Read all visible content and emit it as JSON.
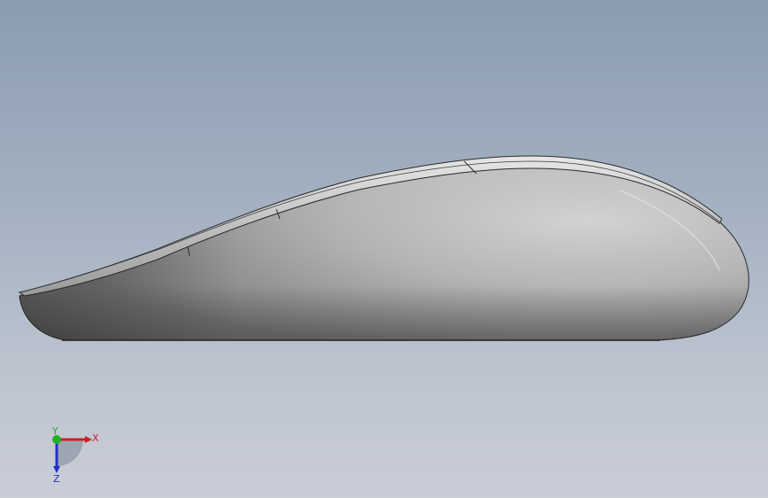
{
  "viewport": {
    "background_top": "#8b9cb1",
    "background_bottom": "#c9cdd6"
  },
  "model": {
    "object": "mouse",
    "view": "side",
    "body_color": "#c8c8c8",
    "edge_color": "#2a2a2a"
  },
  "triad": {
    "x_label": "X",
    "y_label": "Y",
    "z_label": "Z",
    "x_color": "#d01f1f",
    "y_color": "#22b022",
    "z_color": "#2030c8"
  }
}
